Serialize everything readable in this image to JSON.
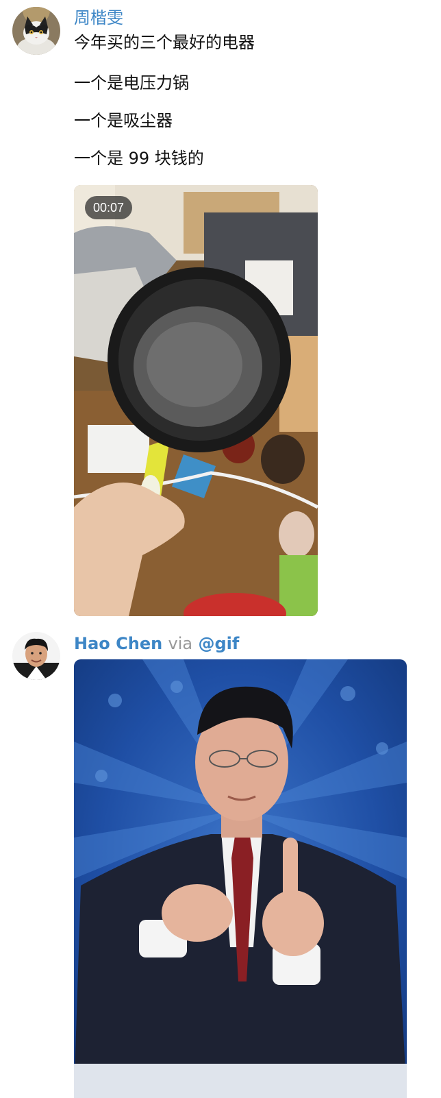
{
  "messages": [
    {
      "sender": "周楷雯",
      "lines": [
        "今年买的三个最好的电器",
        "一个是电压力锅",
        "一个是吸尘器",
        "一个是 99 块钱的"
      ],
      "avatar_icon": "cat-avatar",
      "video": {
        "duration": "00:07"
      }
    },
    {
      "sender": "Hao Chen",
      "via_label": "via",
      "via_bot": "@gif",
      "avatar_icon": "man-avatar"
    }
  ],
  "colors": {
    "link": "#3d86c6",
    "muted": "#999999",
    "text": "#111111"
  }
}
